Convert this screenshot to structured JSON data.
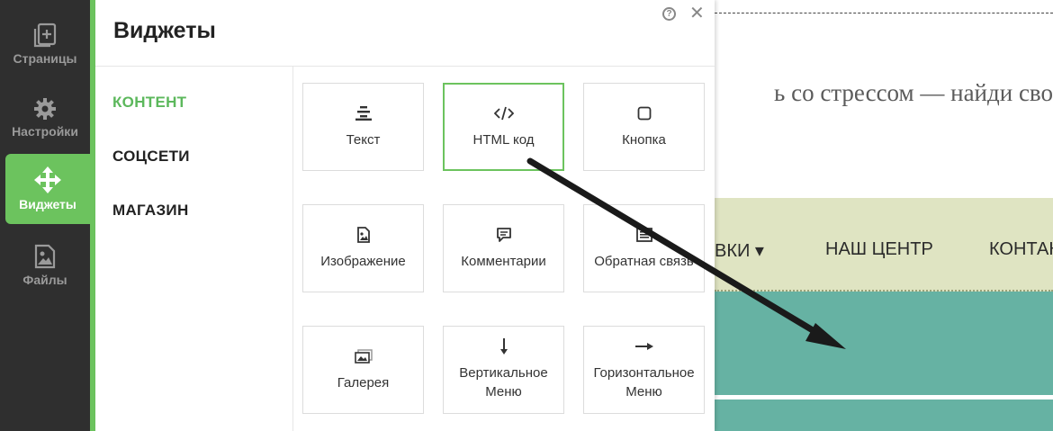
{
  "sidebar": {
    "items": [
      {
        "label": "Страницы",
        "icon": "pages-icon"
      },
      {
        "label": "Настройки",
        "icon": "gear-icon"
      },
      {
        "label": "Виджеты",
        "icon": "move-icon",
        "active": true
      },
      {
        "label": "Файлы",
        "icon": "file-image-icon"
      }
    ]
  },
  "panel": {
    "title": "Виджеты",
    "help_symbol": "?",
    "close_symbol": "✕",
    "categories": [
      {
        "label": "КОНТЕНТ",
        "active": true
      },
      {
        "label": "СОЦСЕТИ"
      },
      {
        "label": "МАГАЗИН"
      }
    ],
    "widgets": [
      {
        "label": "Текст",
        "icon": "text-align-icon"
      },
      {
        "label": "HTML код",
        "icon": "code-icon",
        "selected": true
      },
      {
        "label": "Кнопка",
        "icon": "button-square-icon"
      },
      {
        "label": "Изображение",
        "icon": "image-file-icon"
      },
      {
        "label": "Комментарии",
        "icon": "comment-icon"
      },
      {
        "label": "Обратная связь",
        "icon": "form-icon"
      },
      {
        "label": "Галерея",
        "icon": "gallery-icon"
      },
      {
        "label": "Вертикальное Меню",
        "icon": "arrow-down-icon"
      },
      {
        "label": "Горизонтальное Меню",
        "icon": "arrow-right-icon"
      }
    ]
  },
  "website": {
    "tagline": "ь со стрессом — найди сво",
    "nav": [
      {
        "label": "ВКИ ▾"
      },
      {
        "label": "НАШ ЦЕНТР"
      },
      {
        "label": "КОНТАК"
      }
    ]
  },
  "colors": {
    "accent_green": "#6cc35e",
    "sidebar_bg": "#2f2f2f",
    "nav_bg": "#dfe4c2",
    "hero_bg": "#66b2a3"
  }
}
